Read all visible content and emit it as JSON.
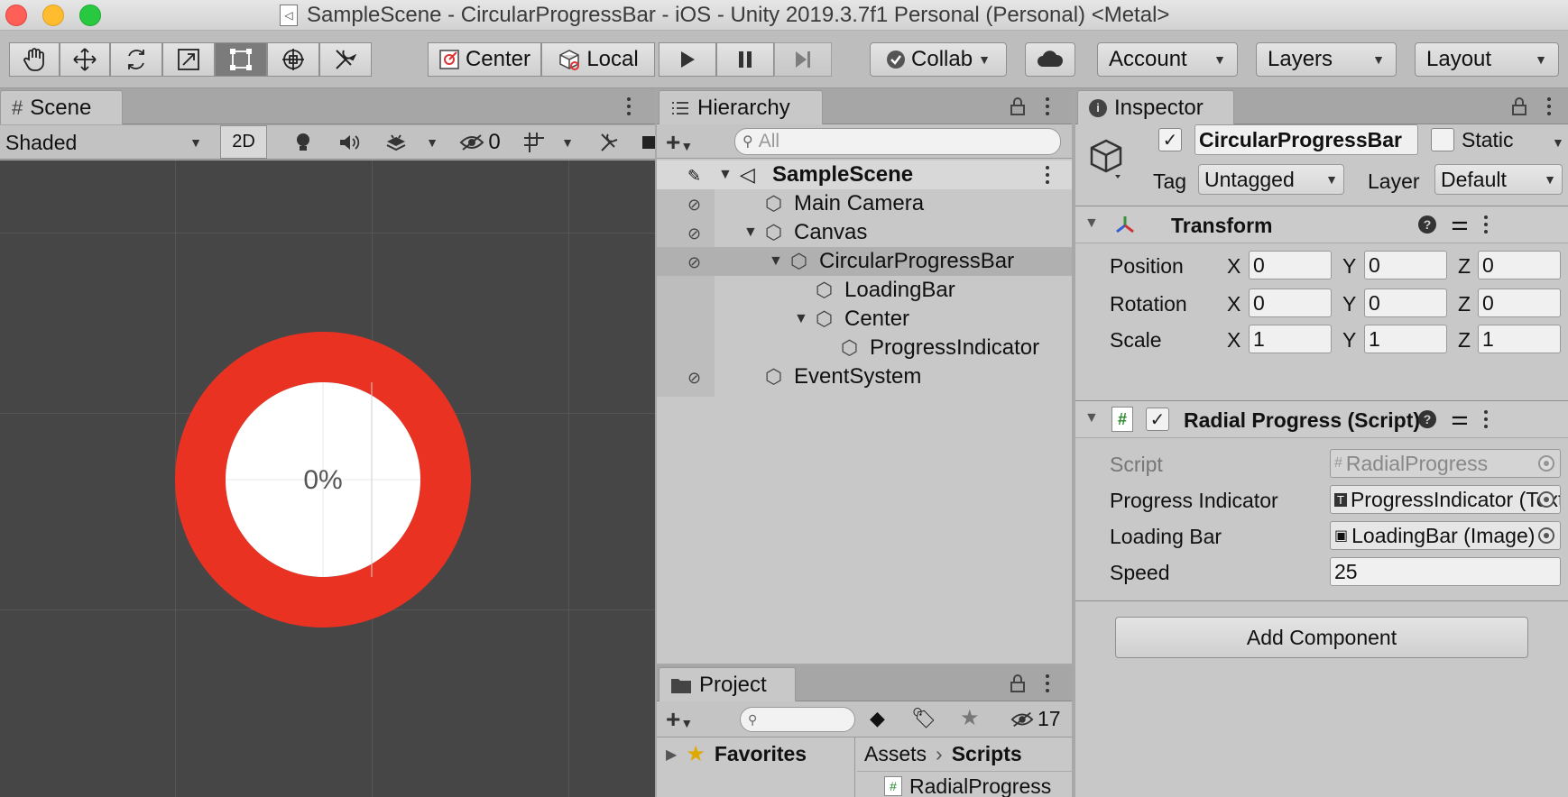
{
  "window": {
    "title": "SampleScene - CircularProgressBar - iOS - Unity 2019.3.7f1 Personal (Personal) <Metal>"
  },
  "toolbar": {
    "pivot_label": "Center",
    "space_label": "Local",
    "collab_label": "Collab",
    "account_label": "Account",
    "layers_label": "Layers",
    "layout_label": "Layout"
  },
  "scene": {
    "tab_label": "Scene",
    "shading_mode": "Shaded",
    "mode_2d_label": "2D",
    "hidden_count": "0",
    "progress_text": "0%",
    "ring_color": "#ea3223"
  },
  "hierarchy": {
    "tab_label": "Hierarchy",
    "search_placeholder": "All",
    "items": [
      {
        "label": "SampleScene"
      },
      {
        "label": "Main Camera"
      },
      {
        "label": "Canvas"
      },
      {
        "label": "CircularProgressBar"
      },
      {
        "label": "LoadingBar"
      },
      {
        "label": "Center"
      },
      {
        "label": "ProgressIndicator"
      },
      {
        "label": "EventSystem"
      }
    ]
  },
  "project": {
    "tab_label": "Project",
    "hidden_count": "17",
    "favorites_label": "Favorites",
    "breadcrumb_root": "Assets",
    "breadcrumb_current": "Scripts",
    "file_label": "RadialProgress"
  },
  "inspector": {
    "tab_label": "Inspector",
    "object_name": "CircularProgressBar",
    "static_label": "Static",
    "tag_label": "Tag",
    "tag_value": "Untagged",
    "layer_label": "Layer",
    "layer_value": "Default",
    "transform": {
      "title": "Transform",
      "position_label": "Position",
      "rotation_label": "Rotation",
      "scale_label": "Scale",
      "x_label": "X",
      "y_label": "Y",
      "z_label": "Z",
      "position": {
        "x": "0",
        "y": "0",
        "z": "0"
      },
      "rotation": {
        "x": "0",
        "y": "0",
        "z": "0"
      },
      "scale": {
        "x": "1",
        "y": "1",
        "z": "1"
      }
    },
    "script_component": {
      "title": "Radial Progress (Script)",
      "script_label": "Script",
      "script_value": "RadialProgress",
      "progress_indicator_label": "Progress Indicator",
      "progress_indicator_value": "ProgressIndicator (Text)",
      "loading_bar_label": "Loading Bar",
      "loading_bar_value": "LoadingBar (Image)",
      "speed_label": "Speed",
      "speed_value": "25"
    },
    "add_component_label": "Add Component"
  }
}
